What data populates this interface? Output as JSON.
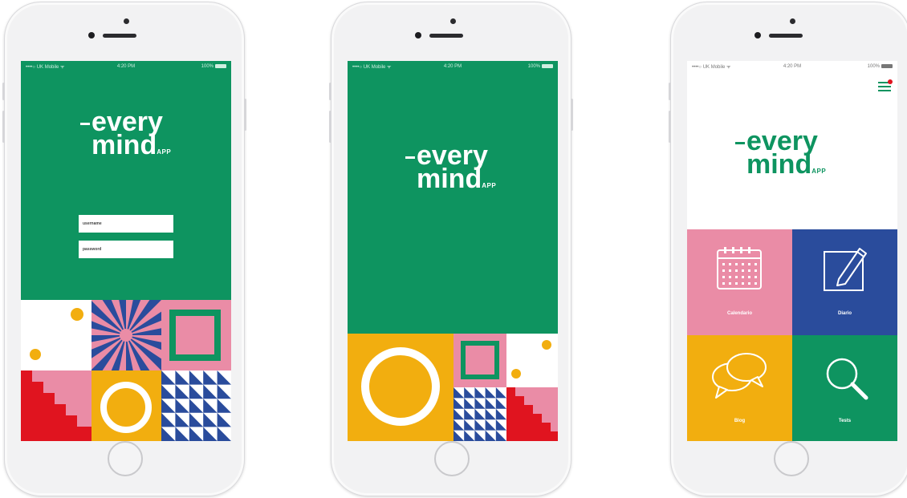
{
  "phones": [
    {
      "status": {
        "carrier": "••••○ UK Mobile ᯤ",
        "time": "4:20 PM",
        "battery": "100%"
      },
      "logo": {
        "line1": "every",
        "line2": "mind",
        "suffix": "APP"
      },
      "login": {
        "username_placeholder": "username",
        "password_placeholder": "password"
      }
    },
    {
      "status": {
        "carrier": "••••○ UK Mobile ᯤ",
        "time": "4:20 PM",
        "battery": "100%"
      },
      "logo": {
        "line1": "every",
        "line2": "mind",
        "suffix": "APP"
      }
    },
    {
      "status": {
        "carrier": "••••○ UK Mobile ᯤ",
        "time": "4:20 PM",
        "battery": "100%"
      },
      "logo": {
        "line1": "every",
        "line2": "mind",
        "suffix": "APP"
      },
      "menu": [
        {
          "label": "Calendario",
          "icon": "calendar-icon",
          "color": "#ea8ca6"
        },
        {
          "label": "Diario",
          "icon": "pencil-note-icon",
          "color": "#2a4c9c"
        },
        {
          "label": "Blog",
          "icon": "speech-bubbles-icon",
          "color": "#f2ae0f"
        },
        {
          "label": "Tests",
          "icon": "magnifier-icon",
          "color": "#0e9460"
        }
      ]
    }
  ],
  "colors": {
    "green": "#0e9460",
    "pink": "#ea8ca6",
    "blue": "#2a4c9c",
    "yellow": "#f2ae0f",
    "red": "#e0141f",
    "white": "#ffffff"
  }
}
